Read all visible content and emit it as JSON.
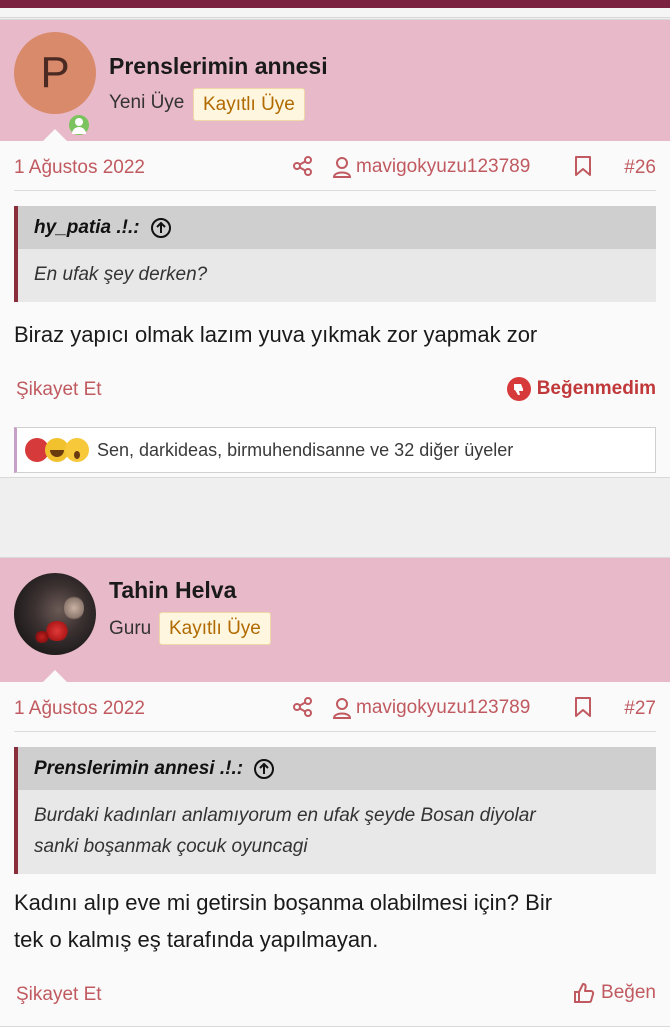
{
  "colors": {
    "accent": "#c05a60",
    "header_bg": "#e8b9c8",
    "topbar": "#7a2240",
    "dislike": "#c0383a",
    "badge_text": "#b06a00"
  },
  "posts": [
    {
      "author": "Prenslerimin annesi",
      "avatar_letter": "P",
      "user_title": "Yeni Üye",
      "badge": "Kayıtlı Üye",
      "date": "1 Ağustos 2022",
      "poster": "mavigokyuzu123789",
      "number": "#26",
      "quote_author": "hy_patia .!.:",
      "quote_text": "En ufak şey derken?",
      "content": "Biraz yapıcı olmak lazım yuva yıkmak zor yapmak zor",
      "report_label": "Şikayet Et",
      "reaction_label": "Beğenmedim",
      "reactions_summary": "Sen, darkideas, birmuhendisanne ve 32 diğer üyeler"
    },
    {
      "author": "Tahin Helva",
      "user_title": "Guru",
      "badge": "Kayıtlı Üye",
      "date": "1 Ağustos 2022",
      "poster": "mavigokyuzu123789",
      "number": "#27",
      "quote_author": "Prenslerimin annesi .!.:",
      "quote_text_1": "Burdaki kadınları anlamıyorum en ufak şeyde Bosan diyolar",
      "quote_text_2": "sanki boşanmak çocuk oyuncagi",
      "content_1": "Kadını alıp eve mi getirsin boşanma olabilmesi için? Bir",
      "content_2": "tek o kalmış eş tarafında yapılmayan.",
      "report_label": "Şikayet Et",
      "reaction_label": "Beğen"
    }
  ]
}
